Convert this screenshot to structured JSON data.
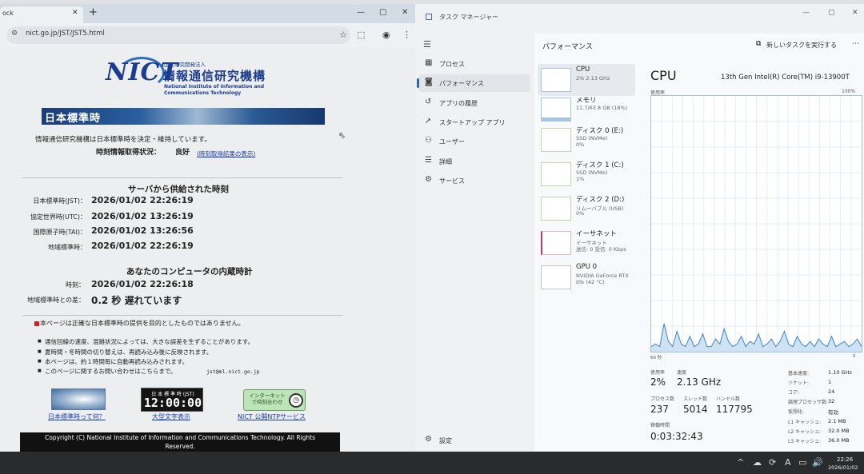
{
  "browser": {
    "tab_title": "ock",
    "tab_close": "✕",
    "new_tab": "+",
    "url": "nict.go.jp/JST/JST5.html",
    "min": "—",
    "max": "▢",
    "close": "✕"
  },
  "page": {
    "logo_mark": "NICT",
    "logo_small": "国立研究開発法人",
    "logo_main": "情報通信研究機構",
    "logo_en1": "National Institute of Information and",
    "logo_en2": "Communications Technology",
    "banner": "日本標準時",
    "intro": "情報通信研究機構は日本標準時を決定・維持しています。",
    "status_label": "時刻情報取得状況：",
    "status_value": "良好",
    "status_link": "(時刻取得結果の表示)",
    "server_heading": "サーバから供給された時刻",
    "server_times": [
      {
        "label": "日本標準時(JST)：",
        "value": "2026/01/02 22:26:19"
      },
      {
        "label": "協定世界時(UTC)：",
        "value": "2026/01/02 13:26:19"
      },
      {
        "label": "国際原子時(TAI)：",
        "value": "2026/01/02 13:26:56"
      },
      {
        "label": "地域標準時：",
        "value": "2026/01/02 22:26:19"
      }
    ],
    "pc_heading": "あなたのコンピュータの内蔵時計",
    "pc_time_label": "時刻：",
    "pc_time_value": "2026/01/02 22:26:18",
    "diff_label": "地域標準時との差：",
    "diff_value": "0.2 秒 遅れています",
    "notice": "本ページは正確な日本標準時の提供を目的としたものではありません。",
    "bullets": [
      "通信回線の速度、混雑状況によっては、大きな誤差を生ずることがあります。",
      "夏時間・冬時間の切り替えは、再読み込み後に反映されます。",
      "本ページは、約１時間毎に自動再読み込みされます。",
      "このページに関するお問い合わせはこちらまで。"
    ],
    "mail": "jst@ml.nict.go.jp",
    "link1": "日本標準時って何？",
    "clock_caption": "日 本 標 準 時 (JST)",
    "clock_time": "12:00:00",
    "link2": "大型文字表示",
    "ntp_text": "インターネットで時刻合わせ",
    "link3": "NICT 公開NTPサービス",
    "copyright_line1": "Copyright (C) National Institute of Information and Communications Technology. All Rights",
    "copyright_line2": "Reserved."
  },
  "taskmgr": {
    "title": "タスク マネージャー",
    "nav": [
      {
        "icon": "▦",
        "label": "プロセス"
      },
      {
        "icon": "◙",
        "label": "パフォーマンス"
      },
      {
        "icon": "↺",
        "label": "アプリの履歴"
      },
      {
        "icon": "➚",
        "label": "スタートアップ アプリ"
      },
      {
        "icon": "⚇",
        "label": "ユーザー"
      },
      {
        "icon": "☰",
        "label": "詳細"
      },
      {
        "icon": "⚙",
        "label": "サービス"
      }
    ],
    "settings": "設定",
    "settings_icon": "⚙",
    "perf_title": "パフォーマンス",
    "run_task": "新しいタスクを実行する",
    "items": [
      {
        "name": "CPU",
        "s1": "2%  2.13 GHz",
        "s2": ""
      },
      {
        "name": "メモリ",
        "s1": "11.7/63.8 GB (18%)",
        "s2": ""
      },
      {
        "name": "ディスク 0 (E:)",
        "s1": "SSD (NVMe)",
        "s2": "0%"
      },
      {
        "name": "ディスク 1 (C:)",
        "s1": "SSD (NVMe)",
        "s2": "1%"
      },
      {
        "name": "ディスク 2 (D:)",
        "s1": "リムーバブル (USB)",
        "s2": "0%"
      },
      {
        "name": "イーサネット",
        "s1": "イーサネット",
        "s2": "送信: 0 受信: 0 Kbps"
      },
      {
        "name": "GPU 0",
        "s1": "NVIDIA GeForce RTX ...",
        "s2": "0% (42 °C)"
      }
    ],
    "cpu_heading": "CPU",
    "cpu_model": "13th Gen Intel(R) Core(TM) i9-13900T",
    "usage_label": "使用率",
    "usage_max": "100%",
    "graph_left": "60 秒",
    "graph_right": "0",
    "graph_values": [
      2,
      3,
      2,
      11,
      4,
      2,
      8,
      3,
      2,
      6,
      2,
      3,
      7,
      2,
      2,
      5,
      3,
      9,
      4,
      2,
      3,
      6,
      2,
      4,
      3,
      7,
      2,
      3,
      5,
      2,
      4,
      8,
      3,
      2,
      6,
      3,
      2,
      4,
      2,
      5,
      3,
      2,
      6,
      2,
      3,
      4,
      2,
      3,
      5,
      2
    ],
    "stats": {
      "usage_label": "使用率",
      "usage": "2%",
      "speed_label": "速度",
      "speed": "2.13 GHz",
      "proc_label": "プロセス数",
      "proc": "237",
      "thread_label": "スレッド数",
      "thread": "5014",
      "handle_label": "ハンドル数",
      "handle": "117795",
      "uptime_label": "稼働時間",
      "uptime": "0:03:32:43"
    },
    "right_stats": [
      {
        "label": "基本速度:",
        "value": "1.10 GHz"
      },
      {
        "label": "ソケット:",
        "value": "1"
      },
      {
        "label": "コア:",
        "value": "24"
      },
      {
        "label": "論理プロセッサ数:",
        "value": "32"
      },
      {
        "label": "仮想化:",
        "value": "有効"
      },
      {
        "label": "L1 キャッシュ:",
        "value": "2.1 MB"
      },
      {
        "label": "L2 キャッシュ:",
        "value": "32.0 MB"
      },
      {
        "label": "L3 キャッシュ:",
        "value": "36.0 MB"
      }
    ],
    "colors": {
      "accent": "#2d63c8",
      "graph_line": "#3b86c6",
      "graph_fill": "#cfe2f3"
    }
  },
  "taskbar": {
    "time": "22:26",
    "date": "2026/01/02",
    "tray": [
      "^",
      "☁",
      "⟳",
      "A",
      "▭",
      "🔊"
    ]
  }
}
